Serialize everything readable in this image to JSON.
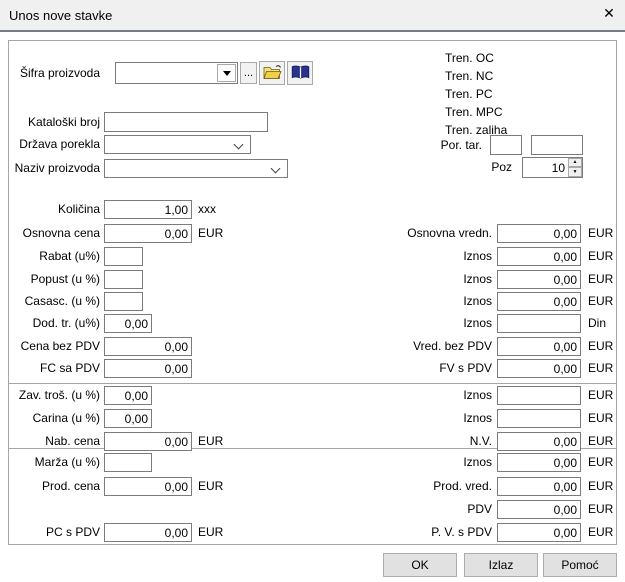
{
  "window": {
    "title": "Unos nove stavke"
  },
  "icons": {
    "close": "✕",
    "ellipsis": "...",
    "spin_up": "▲",
    "spin_down": "▼"
  },
  "top_left": {
    "sifra_label": "Šifra proizvoda",
    "sifra_value": "",
    "kataloski_label": "Kataloški broj",
    "kataloski_value": "",
    "drzava_label": "Država porekla",
    "drzava_value": "",
    "naziv_label": "Naziv proizvoda",
    "naziv_value": ""
  },
  "top_right": {
    "tren_oc": "Tren. OC",
    "tren_nc": "Tren. NC",
    "tren_pc": "Tren. PC",
    "tren_mpc": "Tren. MPC",
    "tren_zaliha": "Tren. zaliha",
    "por_tar_label": "Por. tar.",
    "por_tar_value1": "",
    "por_tar_value2": "",
    "poz_label": "Poz",
    "poz_value": "10"
  },
  "section1": {
    "left": [
      {
        "label": "Količina",
        "value": "1,00",
        "suffix": "xxx"
      },
      {
        "label": "Osnovna cena",
        "value": "0,00",
        "suffix": "EUR"
      },
      {
        "label": "Rabat (u%)",
        "value": "",
        "suffix": ""
      },
      {
        "label": "Popust (u %)",
        "value": "",
        "suffix": ""
      },
      {
        "label": "Casasc. (u %)",
        "value": "",
        "suffix": ""
      },
      {
        "label": "Dod. tr. (u%)",
        "value": "0,00",
        "suffix": ""
      },
      {
        "label": "Cena bez PDV",
        "value": "0,00",
        "suffix": ""
      },
      {
        "label": "FC sa PDV",
        "value": "0,00",
        "suffix": ""
      }
    ],
    "right": [
      {
        "label": "Osnovna vredn.",
        "value": "0,00",
        "suffix": "EUR"
      },
      {
        "label": "Iznos",
        "value": "0,00",
        "suffix": "EUR"
      },
      {
        "label": "Iznos",
        "value": "0,00",
        "suffix": "EUR"
      },
      {
        "label": "Iznos",
        "value": "0,00",
        "suffix": "EUR"
      },
      {
        "label": "Iznos",
        "value": "",
        "suffix": "Din"
      },
      {
        "label": "Vred. bez PDV",
        "value": "0,00",
        "suffix": "EUR"
      },
      {
        "label": "FV s PDV",
        "value": "0,00",
        "suffix": "EUR"
      }
    ]
  },
  "section2": {
    "left": [
      {
        "label": "Zav. troš. (u %)",
        "value": "0,00",
        "suffix": ""
      },
      {
        "label": "Carina (u %)",
        "value": "0,00",
        "suffix": ""
      },
      {
        "label": "Nab. cena",
        "value": "0,00",
        "suffix": "EUR"
      }
    ],
    "right": [
      {
        "label": "Iznos",
        "value": "",
        "suffix": "EUR"
      },
      {
        "label": "Iznos",
        "value": "",
        "suffix": "EUR"
      },
      {
        "label": "N.V.",
        "value": "0,00",
        "suffix": "EUR"
      }
    ]
  },
  "section3": {
    "left": [
      {
        "label": "Marža (u %)",
        "value": "",
        "suffix": ""
      },
      {
        "label": "Prod. cena",
        "value": "0,00",
        "suffix": "EUR"
      },
      {
        "label": "PC s PDV",
        "value": "0,00",
        "suffix": "EUR"
      }
    ],
    "right": [
      {
        "label": "Iznos",
        "value": "0,00",
        "suffix": "EUR"
      },
      {
        "label": "Prod. vred.",
        "value": "0,00",
        "suffix": "EUR"
      },
      {
        "label": "PDV",
        "value": "0,00",
        "suffix": "EUR"
      },
      {
        "label": "P. V. s PDV",
        "value": "0,00",
        "suffix": "EUR"
      }
    ]
  },
  "buttons": {
    "ok": "OK",
    "izlaz": "Izlaz",
    "pomoc": "Pomoć"
  }
}
